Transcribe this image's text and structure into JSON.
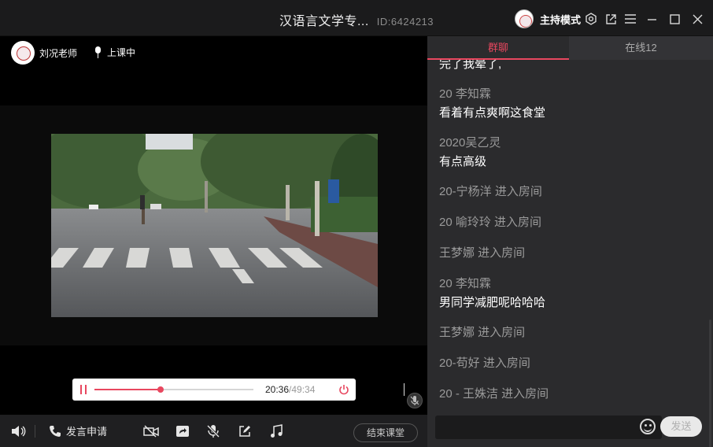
{
  "window": {
    "title": "汉语言文学专...",
    "room_id": "ID:6424213",
    "host_mode_label": "主持模式"
  },
  "stage": {
    "teacher_name": "刘况老师",
    "status_label": "上课中"
  },
  "player": {
    "current_time": "20:36",
    "total_time": "/49:34",
    "progress": 0.415
  },
  "toolbar": {
    "apply_speak_label": "发言申请",
    "end_class_label": "结束课堂"
  },
  "chat": {
    "tabs": {
      "group": "群聊",
      "online": "在线12"
    },
    "cut_line": "完了我晕了,",
    "messages": [
      {
        "sender": "20 李知霖",
        "text": "看着有点爽啊这食堂"
      },
      {
        "sender": "2020吴乙灵",
        "text": "有点高级"
      },
      {
        "system": "20-宁杨洋 进入房间"
      },
      {
        "system": "20  喻玲玲 进入房间"
      },
      {
        "system": "王梦娜 进入房间"
      },
      {
        "sender": "20 李知霖",
        "text": "男同学减肥呢哈哈哈"
      },
      {
        "system": "王梦娜 进入房间"
      },
      {
        "system": "20-苟好 进入房间"
      },
      {
        "system": "20 - 王姝洁 进入房间"
      }
    ],
    "send_label": "发送"
  }
}
